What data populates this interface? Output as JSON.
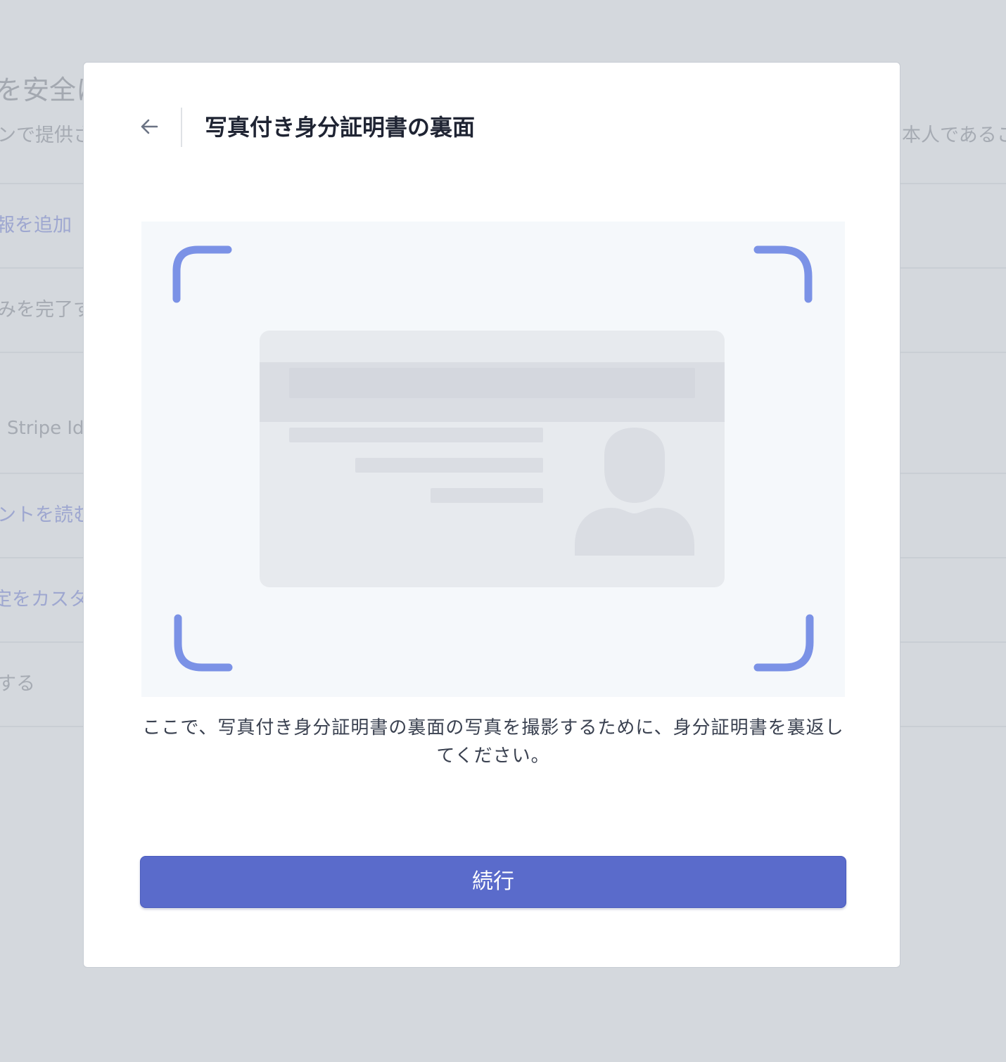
{
  "background": {
    "title_fragment": "を安全に",
    "subtitle_left_fragment": "ンで提供さ",
    "subtitle_right_fragment": "本人であるこ",
    "rows": [
      {
        "text": "報を追加",
        "link": true
      },
      {
        "text": "みを完了す",
        "link": false
      },
      {
        "text": "Stripe Id",
        "link": false
      },
      {
        "text": "ントを読む",
        "link": true
      },
      {
        "text": "定をカスタ",
        "link": true
      },
      {
        "text": "する",
        "link": false
      }
    ]
  },
  "modal": {
    "back_icon": "arrow-left-icon",
    "title": "写真付き身分証明書の裏面",
    "illustration_icon": "id-card-back-with-scan-frame",
    "instruction": "ここで、写真付き身分証明書の裏面の写真を撮影するために、身分証明書を裏返してください。",
    "continue_label": "続行"
  },
  "colors": {
    "overlay_background": "#d4d8dd",
    "accent": "#5a6bcb",
    "scan_frame": "#7b92e6",
    "card": "#e7eaee",
    "illustration_bg": "#f5f8fb"
  }
}
